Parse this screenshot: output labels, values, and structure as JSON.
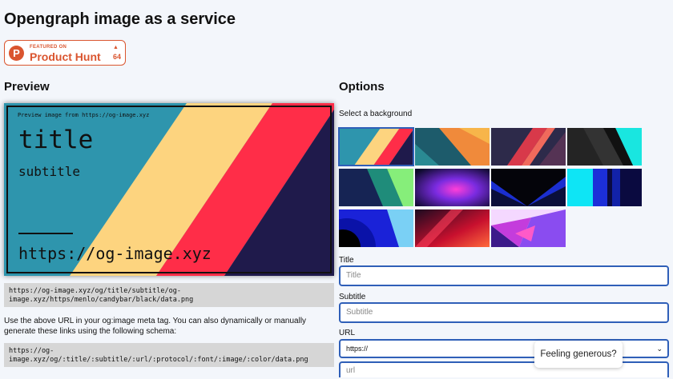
{
  "page": {
    "title": "Opengraph image as a service"
  },
  "product_hunt": {
    "featured": "FEATURED ON",
    "name": "Product Hunt",
    "logo_letter": "P",
    "count": "64",
    "color": "#da552f"
  },
  "preview": {
    "heading": "Preview",
    "note": "Preview image from https://og-image.xyz",
    "title": "title",
    "subtitle": "subtitle",
    "url": "https://og-image.xyz"
  },
  "generated_url": "https://og-image.xyz/og/title/subtitle/og-image.xyz/https/menlo/candybar/black/data.png",
  "instructions": "Use the above URL in your og:image meta tag. You can also dynamically or manually generate these links using the following schema:",
  "schema": "https://og-image.xyz/og/:title/:subtitle/:url/:protocol/:font/:image/:color/data.png",
  "options": {
    "heading": "Options",
    "background_label": "Select a background",
    "title_label": "Title",
    "title_placeholder": "Title",
    "subtitle_label": "Subtitle",
    "subtitle_placeholder": "Subtitle",
    "url_label": "URL",
    "protocol_value": "https://",
    "url_placeholder": "url"
  },
  "backgrounds": [
    {
      "name": "candybar",
      "selected": true
    },
    {
      "name": "orange-teal"
    },
    {
      "name": "red-navy"
    },
    {
      "name": "black-cyan"
    },
    {
      "name": "green-navy"
    },
    {
      "name": "purple-glow"
    },
    {
      "name": "dark-blue-v"
    },
    {
      "name": "cyan-blue-bars"
    },
    {
      "name": "blue-waves"
    },
    {
      "name": "red-gradient"
    },
    {
      "name": "purple-crystal"
    }
  ],
  "toast": {
    "text": "Feeling generous?"
  },
  "colors": {
    "accent": "#2f5fb8",
    "teal": "#2e95ad",
    "yellow": "#fdd47f",
    "red": "#ff2d48",
    "navy": "#1f1a4b"
  }
}
